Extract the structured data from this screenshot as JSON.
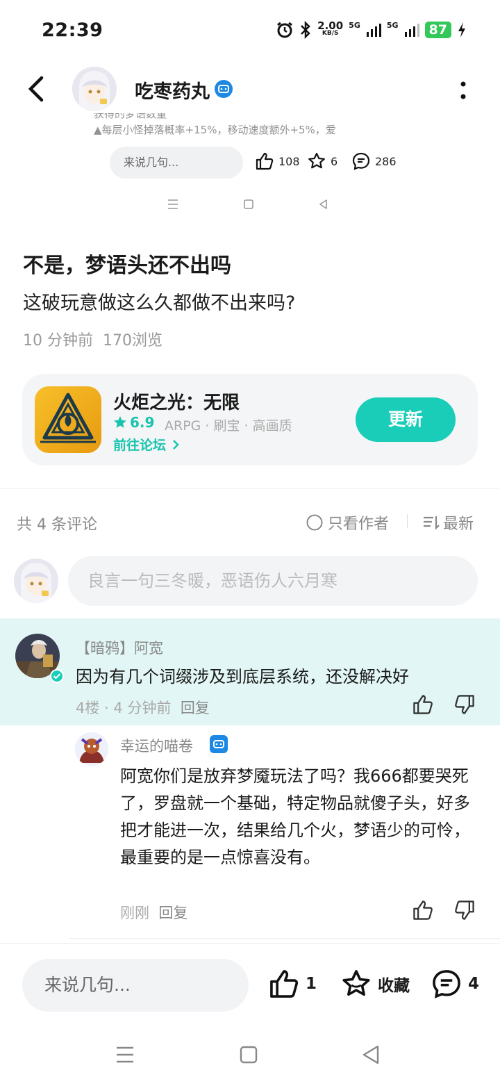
{
  "status_bar": {
    "time": "22:39",
    "net_speed": "2.00",
    "net_unit": "KB/S",
    "sig1": "5G",
    "sig2": "5G",
    "battery": "87"
  },
  "header": {
    "username": "吃枣药丸"
  },
  "embedded": {
    "faded_line1": "获得的梦语数量",
    "faded_line2": "▲每层小怪掉落概率+15%，移动速度额外+5%，爱",
    "input_placeholder": "来说几句...",
    "likes": "108",
    "favorites": "6",
    "comments": "286"
  },
  "post": {
    "title": "不是，梦语头还不出吗",
    "body": "这破玩意做这么久都做不出来吗?",
    "time": "10 分钟前",
    "views": "170浏览"
  },
  "game": {
    "name": "火炬之光：无限",
    "rating": "6.9",
    "tags": "ARPG · 刷宝 · 高画质",
    "forum_link": "前往论坛",
    "update_label": "更新"
  },
  "comments": {
    "count_label": "共 4 条评论",
    "only_author_label": "只看作者",
    "sort_label": "最新",
    "input_placeholder": "良言一句三冬暖，恶语伤人六月寒",
    "items": [
      {
        "user": "【暗鸦】阿宽",
        "text": "因为有几个词缀涉及到底层系统，还没解决好",
        "floor": "4楼",
        "time": "4 分钟前",
        "reply_label": "回复"
      },
      {
        "user": "幸运的喵卷",
        "text": "阿宽你们是放弃梦魇玩法了吗？我666都要哭死了，罗盘就一个基础，特定物品就傻子头，好多把才能进一次，结果给几个火，梦语少的可怜，最重要的是一点惊喜没有。",
        "time": "刚刚",
        "reply_label": "回复"
      }
    ]
  },
  "bottom_bar": {
    "input_placeholder": "来说几句...",
    "likes": "1",
    "favorite_label": "收藏",
    "comments": "4"
  },
  "colors": {
    "accent": "#19cdb8",
    "highlight": "#e2f7f5",
    "badge": "#1e88e5",
    "battery": "#34c759"
  }
}
